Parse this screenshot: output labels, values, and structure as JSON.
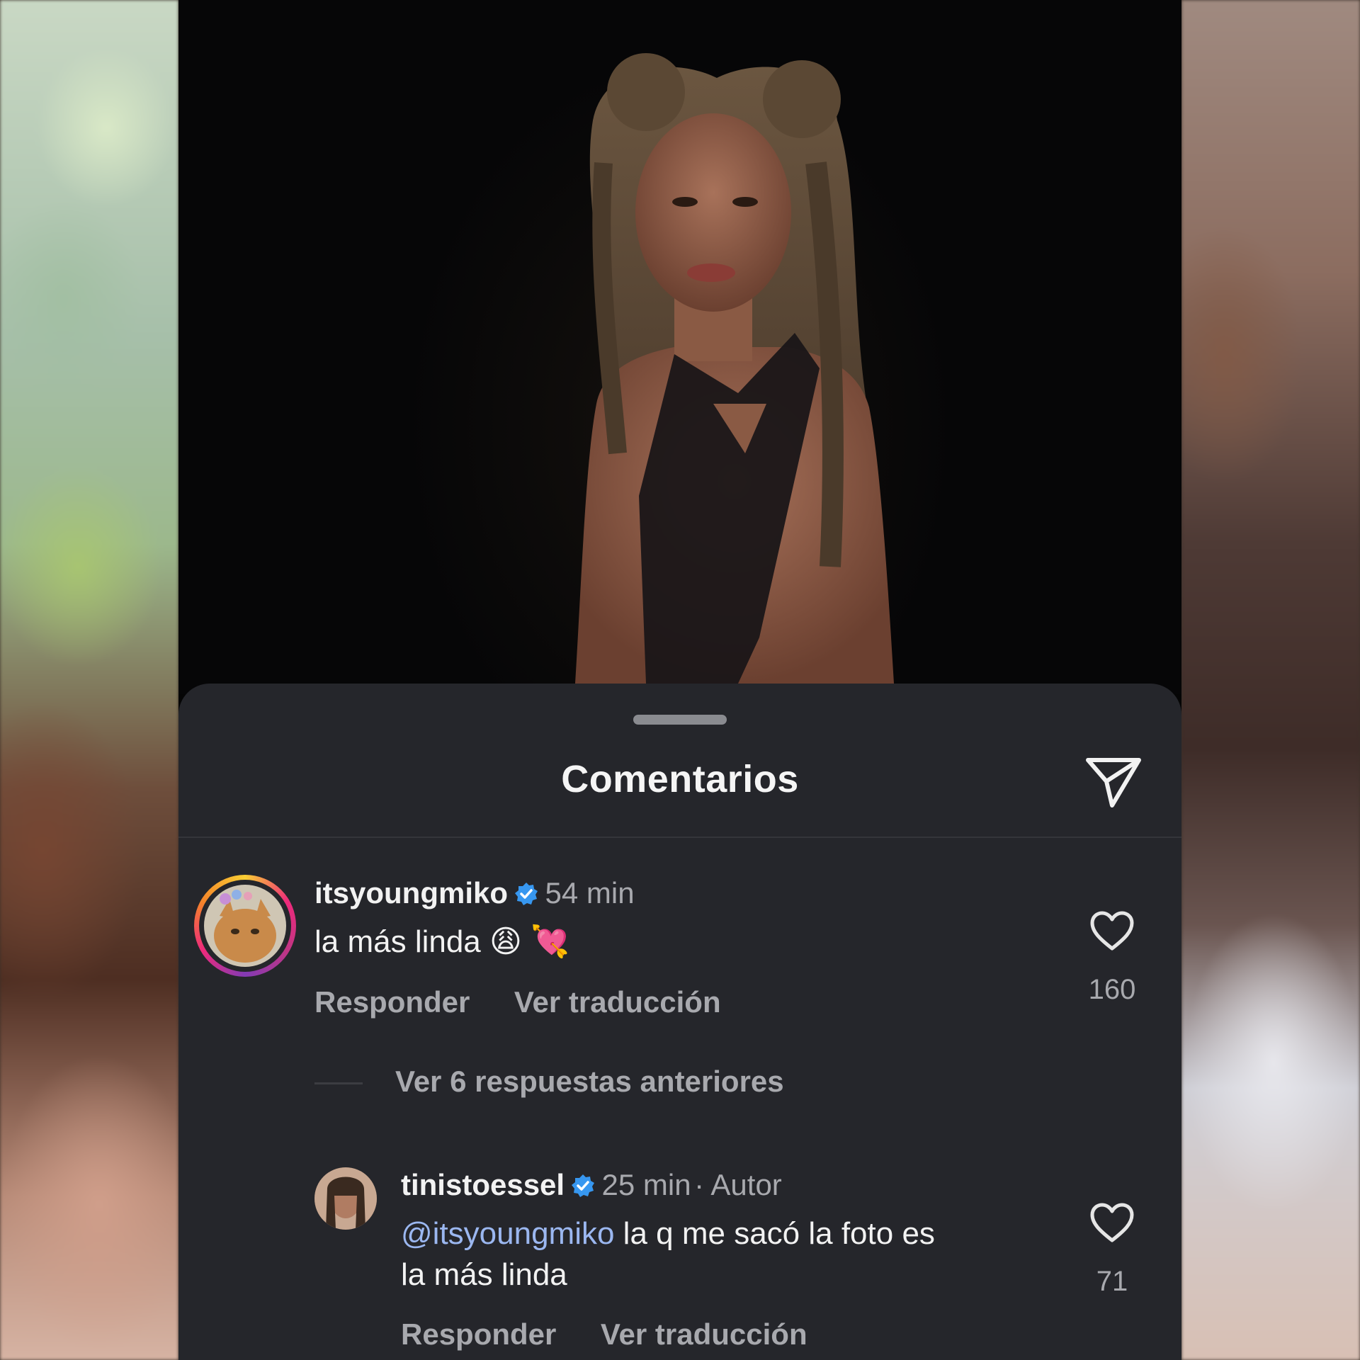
{
  "sheet": {
    "title": "Comentarios"
  },
  "comments": [
    {
      "username": "itsyoungmiko",
      "time": "54 min",
      "text": "la más linda 😩 💘",
      "reply_label": "Responder",
      "translate_label": "Ver traducción",
      "likes": "160"
    },
    {
      "username": "tinistoessel",
      "time": "25 min",
      "author_tag": "· Autor",
      "mention": "@itsyoungmiko",
      "text_line1": " la q me sacó la foto es",
      "text_line2": "la más linda",
      "reply_label": "Responder",
      "translate_label": "Ver traducción",
      "likes": "71"
    }
  ],
  "replies_toggle": "Ver 6 respuestas anteriores",
  "colors": {
    "sheet_bg": "#25262b",
    "verified_blue": "#3797f0",
    "mention_blue": "#9bb7f0"
  },
  "icons": [
    "send-icon",
    "heart-icon",
    "verified-badge-icon"
  ]
}
